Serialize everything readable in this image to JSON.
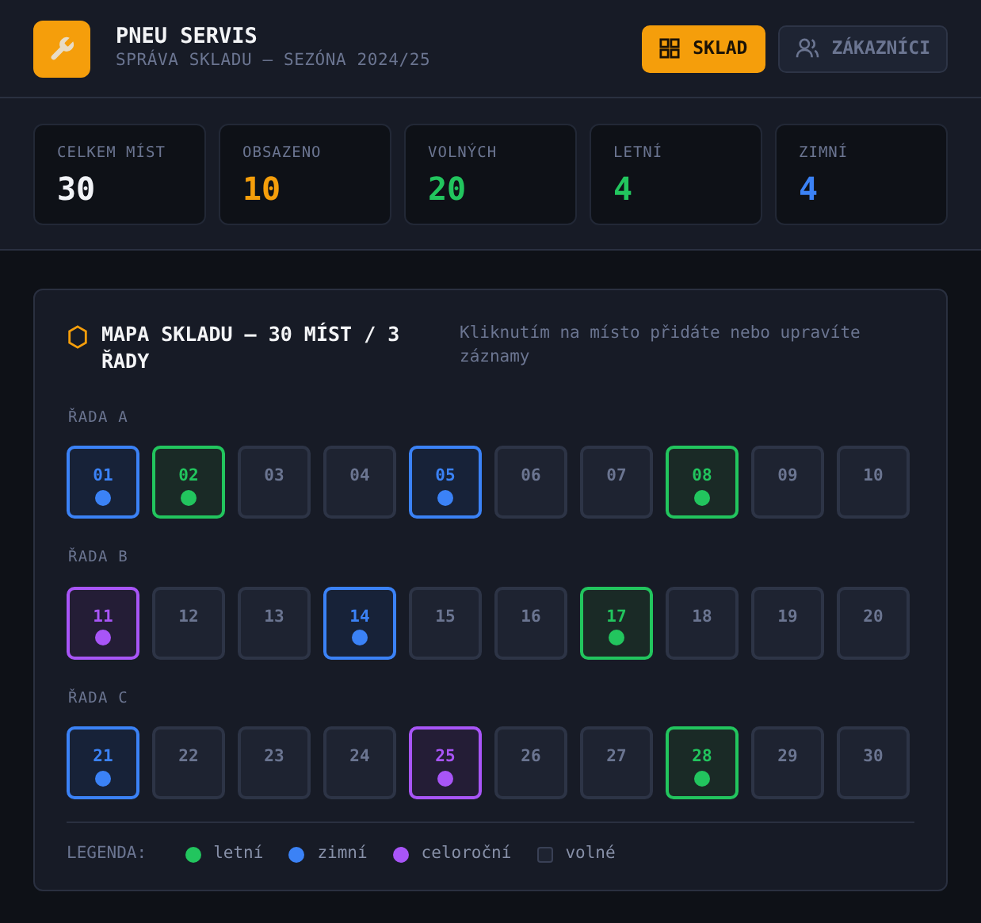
{
  "header": {
    "title": "PNEU SERVIS",
    "subtitle": "SPRÁVA SKLADU — SEZÓNA 2024/25",
    "nav": [
      {
        "label": "SKLAD",
        "selected": true,
        "kind": "grid"
      },
      {
        "label": "ZÁKAZNÍCI",
        "selected": false,
        "kind": "people"
      }
    ]
  },
  "stats": [
    {
      "label": "CELKEM MÍST",
      "value": "30",
      "color": "#f1f3f7"
    },
    {
      "label": "OBSAZENO",
      "value": "10",
      "color": "#f59e0b"
    },
    {
      "label": "VOLNÝCH",
      "value": "20",
      "color": "#22c55e"
    },
    {
      "label": "LETNÍ",
      "value": "4",
      "color": "#22c55e"
    },
    {
      "label": "ZIMNÍ",
      "value": "4",
      "color": "#3b82f6"
    }
  ],
  "map": {
    "title": "MAPA SKLADU — 30 MÍST / 3 ŘADY",
    "hint": "Kliknutím na místo přidáte nebo upravíte záznamy",
    "rows": [
      {
        "label": "ŘADA A",
        "slots": [
          {
            "number": "01",
            "kind": "winter"
          },
          {
            "number": "02",
            "kind": "summer"
          },
          {
            "number": "03",
            "kind": "free"
          },
          {
            "number": "04",
            "kind": "free"
          },
          {
            "number": "05",
            "kind": "winter"
          },
          {
            "number": "06",
            "kind": "free"
          },
          {
            "number": "07",
            "kind": "free"
          },
          {
            "number": "08",
            "kind": "summer"
          },
          {
            "number": "09",
            "kind": "free"
          },
          {
            "number": "10",
            "kind": "free"
          }
        ]
      },
      {
        "label": "ŘADA B",
        "slots": [
          {
            "number": "11",
            "kind": "allyear"
          },
          {
            "number": "12",
            "kind": "free"
          },
          {
            "number": "13",
            "kind": "free"
          },
          {
            "number": "14",
            "kind": "winter"
          },
          {
            "number": "15",
            "kind": "free"
          },
          {
            "number": "16",
            "kind": "free"
          },
          {
            "number": "17",
            "kind": "summer"
          },
          {
            "number": "18",
            "kind": "free"
          },
          {
            "number": "19",
            "kind": "free"
          },
          {
            "number": "20",
            "kind": "free"
          }
        ]
      },
      {
        "label": "ŘADA C",
        "slots": [
          {
            "number": "21",
            "kind": "winter"
          },
          {
            "number": "22",
            "kind": "free"
          },
          {
            "number": "23",
            "kind": "free"
          },
          {
            "number": "24",
            "kind": "free"
          },
          {
            "number": "25",
            "kind": "allyear"
          },
          {
            "number": "26",
            "kind": "free"
          },
          {
            "number": "27",
            "kind": "free"
          },
          {
            "number": "28",
            "kind": "summer"
          },
          {
            "number": "29",
            "kind": "free"
          },
          {
            "number": "30",
            "kind": "free"
          }
        ]
      }
    ],
    "legend": {
      "label": "LEGENDA:",
      "items": [
        {
          "label": "letní",
          "kind": "summer"
        },
        {
          "label": "zimní",
          "kind": "winter"
        },
        {
          "label": "celoroční",
          "kind": "allyear"
        },
        {
          "label": "volné",
          "kind": "free"
        }
      ]
    }
  }
}
